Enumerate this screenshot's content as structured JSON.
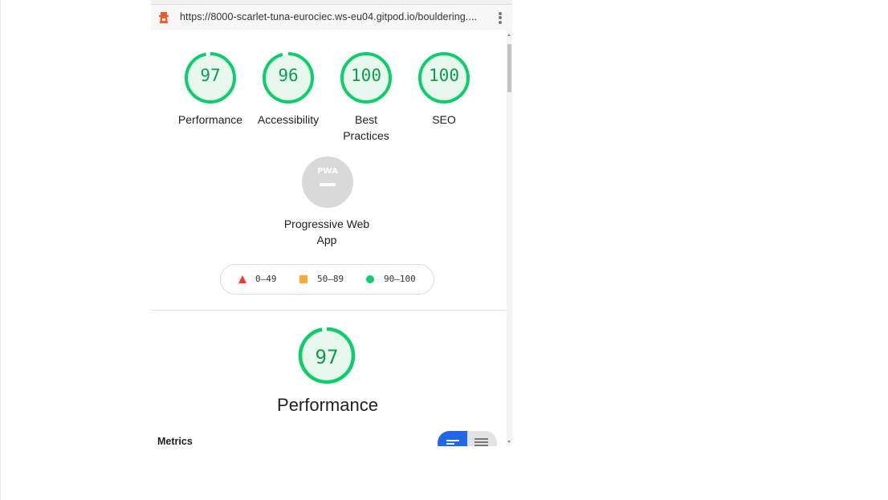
{
  "browser": {
    "url": "https://8000-scarlet-tuna-eurociec.ws-eu04.gitpod.io/bouldering...."
  },
  "categories": [
    {
      "score": "97",
      "label": "Performance",
      "fraction": 0.97
    },
    {
      "score": "96",
      "label": "Accessibility",
      "fraction": 0.96
    },
    {
      "score": "100",
      "label": "Best Practices",
      "fraction": 1.0
    },
    {
      "score": "100",
      "label": "SEO",
      "fraction": 1.0
    }
  ],
  "pwa": {
    "label": "Progressive Web App",
    "badge": "PWA"
  },
  "legend": {
    "fail": "0–49",
    "average": "50–89",
    "pass": "90–100"
  },
  "performance": {
    "score": "97",
    "title": "Performance",
    "fraction": 0.97
  },
  "metrics": {
    "title": "Metrics"
  },
  "colors": {
    "pass": "#0cce6b",
    "pass_text": "#0c9c4a",
    "average": "#ffaa33",
    "fail": "#ff3333",
    "toggle_active": "#2266ee"
  }
}
